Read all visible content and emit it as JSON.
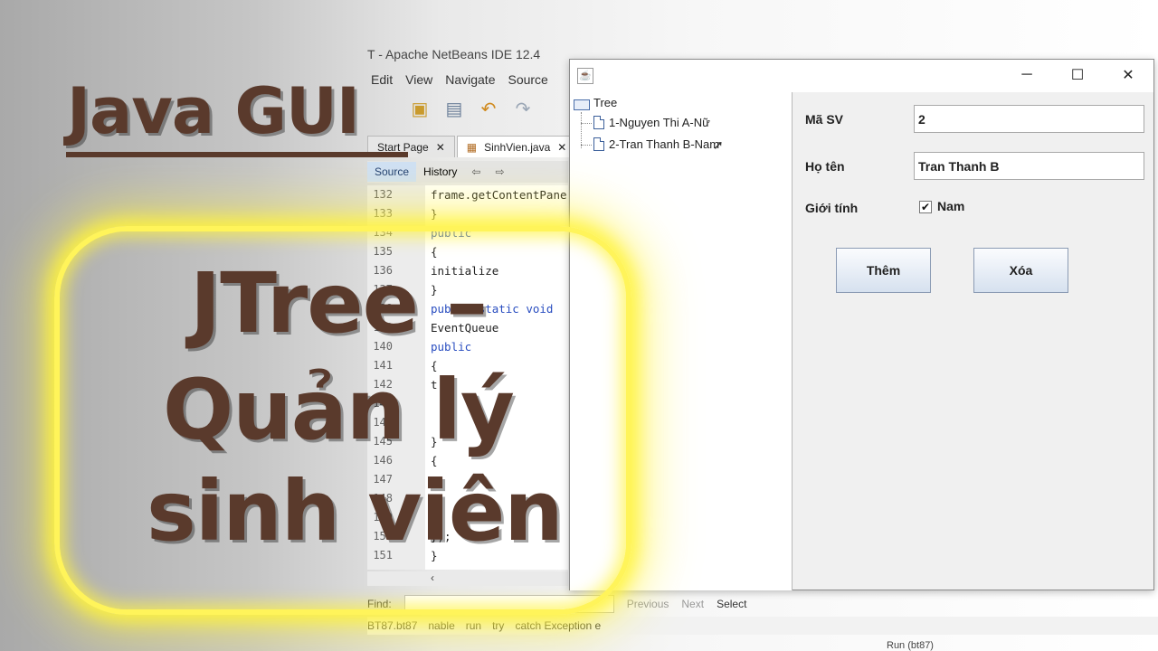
{
  "ide": {
    "title": "T - Apache NetBeans IDE 12.4",
    "menu": [
      "Edit",
      "View",
      "Navigate",
      "Source"
    ],
    "tabs": [
      {
        "label": "Start Page"
      },
      {
        "label": "SinhVien.java"
      }
    ],
    "editor_mode": {
      "source": "Source",
      "history": "History"
    },
    "code_lines": [
      {
        "num": "132",
        "code": "frame.getContentPane()"
      },
      {
        "num": "133",
        "code": "}"
      },
      {
        "num": "134",
        "code": "public"
      },
      {
        "num": "135",
        "code": "{"
      },
      {
        "num": "136",
        "code": "initialize"
      },
      {
        "num": "137",
        "code": "}"
      },
      {
        "num": "138",
        "code": "public static void"
      },
      {
        "num": "139",
        "code": "EventQueue"
      },
      {
        "num": "140",
        "code": "public"
      },
      {
        "num": "141",
        "code": "{"
      },
      {
        "num": "142",
        "code": "t"
      },
      {
        "num": "143",
        "code": ""
      },
      {
        "num": "144",
        "code": ""
      },
      {
        "num": "145",
        "code": "}"
      },
      {
        "num": "146",
        "code": "{"
      },
      {
        "num": "147",
        "code": ""
      },
      {
        "num": "148",
        "code": ""
      },
      {
        "num": "149",
        "code": ""
      },
      {
        "num": "150",
        "code": "});"
      },
      {
        "num": "151",
        "code": "}"
      }
    ],
    "find": {
      "label": "Find:",
      "previous": "Previous",
      "next": "Next",
      "select": "Select"
    },
    "breadcrumbs": [
      "BT87.bt87",
      "nable",
      "run",
      "try",
      "catch Exception e"
    ],
    "status": "Run (bt87)"
  },
  "window": {
    "icon": "java-app-icon",
    "controls": {
      "minimize": "─",
      "maximize": "☐",
      "close": "✕"
    },
    "tree": {
      "root": "Tree",
      "nodes": [
        "1-Nguyen Thi A-Nữ",
        "2-Tran Thanh B-Nam"
      ]
    },
    "form": {
      "ma_sv_label": "Mã SV",
      "ma_sv_value": "2",
      "ho_ten_label": "Họ tên",
      "ho_ten_value": "Tran Thanh B",
      "gioi_tinh_label": "Giới tính",
      "gioi_tinh_checkbox_label": "Nam",
      "gioi_tinh_checked": true,
      "add_button": "Thêm",
      "delete_button": "Xóa"
    }
  },
  "overlay": {
    "title": "Java GUI",
    "headline_line1": "JTree –",
    "headline_line2": "Quản lý",
    "headline_line3": "sinh viên",
    "frame_color": "#fff45a",
    "text_color": "#5a3a2c"
  }
}
